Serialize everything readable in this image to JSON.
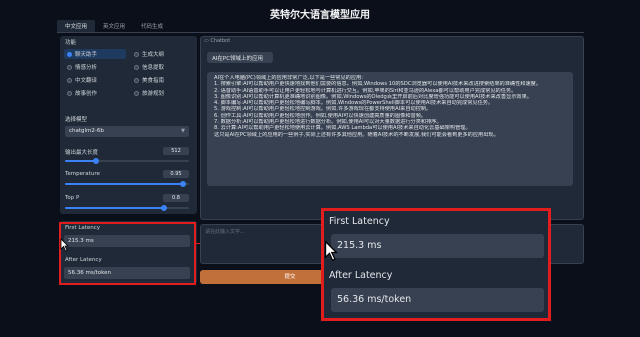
{
  "app": {
    "title": "英特尔大语言模型应用"
  },
  "tabs": [
    {
      "label": "中文应用",
      "active": true
    },
    {
      "label": "英文应用",
      "active": false
    },
    {
      "label": "代码生成",
      "active": false
    }
  ],
  "function_section": {
    "label": "功能",
    "options": [
      {
        "label": "聊天助手",
        "selected": true
      },
      {
        "label": "生成大纲",
        "selected": false
      },
      {
        "label": "情感分析",
        "selected": false
      },
      {
        "label": "信息提取",
        "selected": false
      },
      {
        "label": "中文翻译",
        "selected": false
      },
      {
        "label": "美食指南",
        "selected": false
      },
      {
        "label": "故事创作",
        "selected": false
      },
      {
        "label": "旅游规划",
        "selected": false
      }
    ]
  },
  "model_section": {
    "label": "选择模型",
    "selected": "chatglm2-6b"
  },
  "sliders": {
    "max_length": {
      "label": "输出最大长度",
      "value": "512",
      "fraction": 0.25
    },
    "temperature": {
      "label": "Temperature",
      "value": "0.95",
      "fraction": 0.95
    },
    "top_p": {
      "label": "Top P",
      "value": "0.8",
      "fraction": 0.8
    }
  },
  "latency": {
    "first_label": "First Latency",
    "first_value": "215.3 ms",
    "after_label": "After Latency",
    "after_value": "56.36 ms/token"
  },
  "chat": {
    "label": "Chatbot",
    "user_message": "AI在PC领域上的应用",
    "reply_lines": [
      "AI在个人电脑(PC)领域上的应用非常广泛,以下是一些常见的应用:",
      "1. 搜索引擎:AI可以帮助用户更快速地找到他们需要的信息。例如,Windows 10的SDC浏览器可以使用AI技术来改进搜索结果的准确性和速度。",
      "2. 语音助手:AI语音助手可以让用户更轻松地与计算机进行交互。例如,苹果的Siri和亚马逊的Alexa都可以帮助用户完成常见的任务。",
      "3. 图像识别:AI可以帮助计算机更准确地识别图像。例如,Windows的Oledg百里开启前后对比度增强功能可以使用AI技术来改善显示效果。",
      "4. 脚本编写:AI可以帮助用户更轻松地编写脚本。例如,Windows的PowerShell脚本可以使用AI技术来自动完成常见任务。",
      "5. 游戏控制:AI可以帮助用户更轻松地控制游戏。例如,许多游戏现在都支持使用AI来自动控制。",
      "6. 创作工具:AI可以帮助用户更轻松地创作。例如,使用AI可以快速创建高质量的图像和音频。",
      "7. 数据分析:AI可以帮助用户更轻松地进行数据分析。例如,使用AI可以对大量数据进行分类和排序。",
      "8. 云计算:AI可以帮助用户更轻松地使用云计算。例如,AWS Lambda可以使用AI技术来自动化云基础架构管理。",
      "这只是AI在PC领域上的应用的一些例子,实际上还有许多其他应用。随着AI技术的不断发展,我们可能会看到更多的应用出现。"
    ]
  },
  "input": {
    "placeholder": "请在此输入文字..."
  },
  "submit_label": "提交",
  "colors": {
    "accent": "#3b82f6",
    "highlight": "#e11d1d",
    "submit": "#c2703a"
  }
}
